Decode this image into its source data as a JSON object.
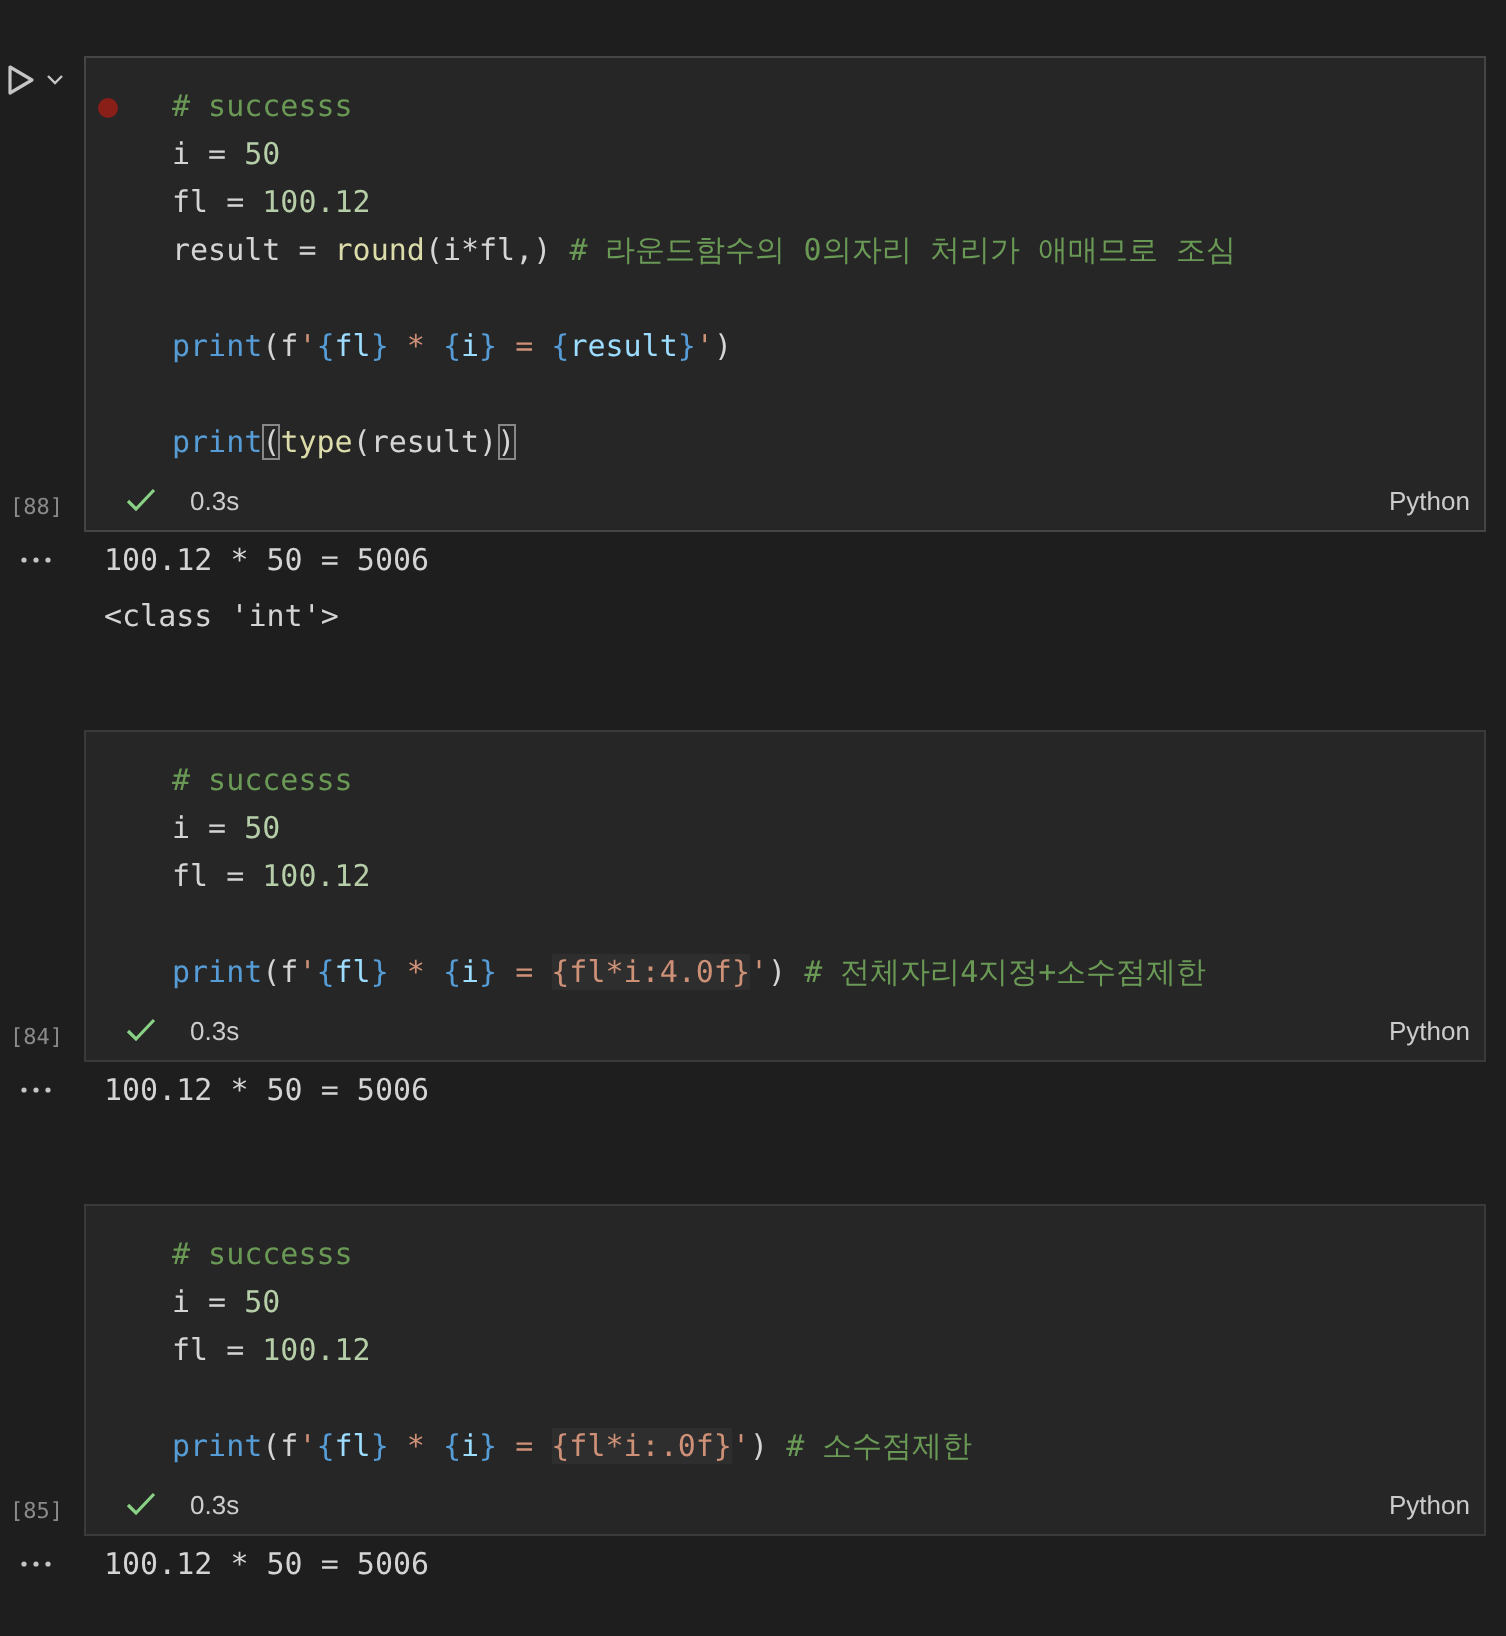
{
  "cells": [
    {
      "selected": true,
      "breakpoint": true,
      "execution_count": "[88]",
      "status": {
        "success": true,
        "time": "0.3s"
      },
      "language": "Python",
      "lines": [
        {
          "kind": "code",
          "tokens": [
            {
              "kind": "comment",
              "text": "# successs"
            }
          ]
        },
        {
          "kind": "code",
          "tokens": [
            {
              "kind": "plain",
              "text": "i = "
            },
            {
              "kind": "number",
              "text": "50"
            }
          ]
        },
        {
          "kind": "code",
          "tokens": [
            {
              "kind": "plain",
              "text": "fl = "
            },
            {
              "kind": "number",
              "text": "100.12"
            }
          ]
        },
        {
          "kind": "code",
          "tokens": [
            {
              "kind": "plain",
              "text": "result = "
            },
            {
              "kind": "func",
              "text": "round"
            },
            {
              "kind": "plain",
              "text": "(i*fl,) "
            },
            {
              "kind": "comment",
              "text": "# 라운드함수의 0의자리 처리가 애매므로 조심"
            }
          ]
        },
        {
          "kind": "blank"
        },
        {
          "kind": "code",
          "tokens": [
            {
              "kind": "keyword",
              "text": "print"
            },
            {
              "kind": "plain",
              "text": "(f"
            },
            {
              "kind": "string",
              "text": "'"
            },
            {
              "kind": "brace",
              "text": "{"
            },
            {
              "kind": "var",
              "text": "fl"
            },
            {
              "kind": "brace",
              "text": "}"
            },
            {
              "kind": "string",
              "text": " * "
            },
            {
              "kind": "brace",
              "text": "{"
            },
            {
              "kind": "var",
              "text": "i"
            },
            {
              "kind": "brace",
              "text": "}"
            },
            {
              "kind": "string",
              "text": " = "
            },
            {
              "kind": "brace",
              "text": "{"
            },
            {
              "kind": "var",
              "text": "result"
            },
            {
              "kind": "brace",
              "text": "}"
            },
            {
              "kind": "string",
              "text": "'"
            },
            {
              "kind": "plain",
              "text": ")"
            }
          ]
        },
        {
          "kind": "blank"
        },
        {
          "kind": "code",
          "tokens": [
            {
              "kind": "keyword",
              "text": "print"
            },
            {
              "kind": "match",
              "text": "("
            },
            {
              "kind": "func",
              "text": "type"
            },
            {
              "kind": "plain",
              "text": "(result)"
            },
            {
              "kind": "match",
              "text": ")"
            }
          ]
        }
      ],
      "outputs": [
        "100.12 * 50 = 5006",
        "<class 'int'>"
      ]
    },
    {
      "selected": false,
      "breakpoint": false,
      "execution_count": "[84]",
      "status": {
        "success": true,
        "time": "0.3s"
      },
      "language": "Python",
      "lines": [
        {
          "kind": "code",
          "tokens": [
            {
              "kind": "comment",
              "text": "# successs"
            }
          ]
        },
        {
          "kind": "code",
          "tokens": [
            {
              "kind": "plain",
              "text": "i = "
            },
            {
              "kind": "number",
              "text": "50"
            }
          ]
        },
        {
          "kind": "code",
          "tokens": [
            {
              "kind": "plain",
              "text": "fl = "
            },
            {
              "kind": "number",
              "text": "100.12"
            }
          ]
        },
        {
          "kind": "blank"
        },
        {
          "kind": "code",
          "tokens": [
            {
              "kind": "keyword",
              "text": "print"
            },
            {
              "kind": "plain",
              "text": "(f"
            },
            {
              "kind": "string",
              "text": "'"
            },
            {
              "kind": "brace",
              "text": "{"
            },
            {
              "kind": "var",
              "text": "fl"
            },
            {
              "kind": "brace",
              "text": "}"
            },
            {
              "kind": "string",
              "text": " * "
            },
            {
              "kind": "brace",
              "text": "{"
            },
            {
              "kind": "var",
              "text": "i"
            },
            {
              "kind": "brace",
              "text": "}"
            },
            {
              "kind": "string",
              "text": " = "
            },
            {
              "kind": "expr",
              "text": "{fl*i:4.0f}"
            },
            {
              "kind": "string",
              "text": "'"
            },
            {
              "kind": "plain",
              "text": ") "
            },
            {
              "kind": "comment",
              "text": "# 전체자리4지정+소수점제한"
            }
          ]
        }
      ],
      "outputs": [
        "100.12 * 50 = 5006"
      ]
    },
    {
      "selected": false,
      "breakpoint": false,
      "execution_count": "[85]",
      "status": {
        "success": true,
        "time": "0.3s"
      },
      "language": "Python",
      "lines": [
        {
          "kind": "code",
          "tokens": [
            {
              "kind": "comment",
              "text": "# successs"
            }
          ]
        },
        {
          "kind": "code",
          "tokens": [
            {
              "kind": "plain",
              "text": "i = "
            },
            {
              "kind": "number",
              "text": "50"
            }
          ]
        },
        {
          "kind": "code",
          "tokens": [
            {
              "kind": "plain",
              "text": "fl = "
            },
            {
              "kind": "number",
              "text": "100.12"
            }
          ]
        },
        {
          "kind": "blank"
        },
        {
          "kind": "code",
          "tokens": [
            {
              "kind": "keyword",
              "text": "print"
            },
            {
              "kind": "plain",
              "text": "(f"
            },
            {
              "kind": "string",
              "text": "'"
            },
            {
              "kind": "brace",
              "text": "{"
            },
            {
              "kind": "var",
              "text": "fl"
            },
            {
              "kind": "brace",
              "text": "}"
            },
            {
              "kind": "string",
              "text": " * "
            },
            {
              "kind": "brace",
              "text": "{"
            },
            {
              "kind": "var",
              "text": "i"
            },
            {
              "kind": "brace",
              "text": "}"
            },
            {
              "kind": "string",
              "text": " = "
            },
            {
              "kind": "expr",
              "text": "{fl*i:.0f}"
            },
            {
              "kind": "string",
              "text": "'"
            },
            {
              "kind": "plain",
              "text": ") "
            },
            {
              "kind": "comment",
              "text": "# 소수점제한"
            }
          ]
        }
      ],
      "outputs": [
        "100.12 * 50 = 5006"
      ]
    }
  ]
}
